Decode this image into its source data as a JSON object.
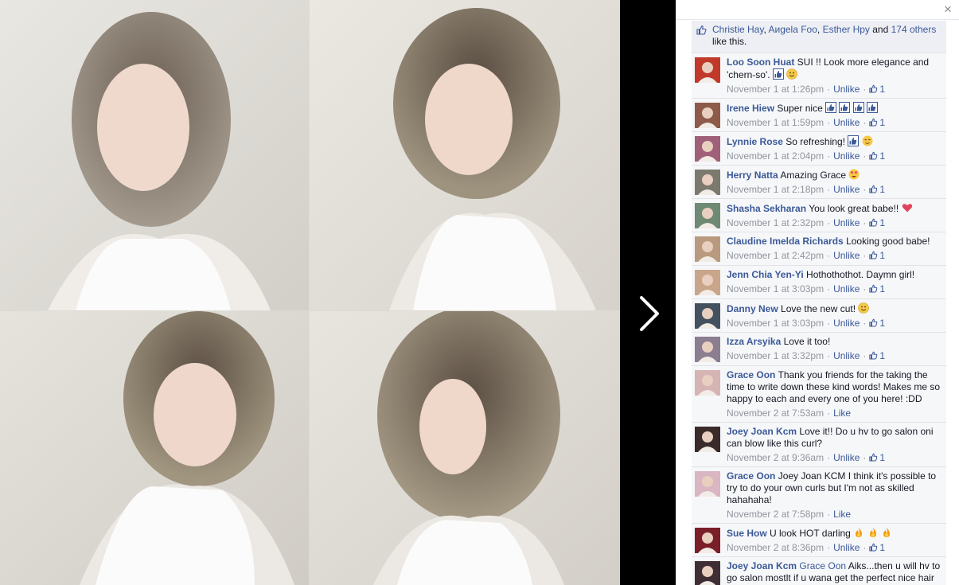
{
  "colors": {
    "link": "#3b5998",
    "meta": "#90949c",
    "panel_bg": "#f6f7f9",
    "stage_bg": "#000000"
  },
  "viewer": {
    "next_icon": "chevron-right-icon",
    "close_label": "×"
  },
  "likes": {
    "names": [
      "Christie Hay",
      "Aиgela Foo",
      "Esther Hpy"
    ],
    "sep1": ", ",
    "sep2": ", ",
    "and_text": " and ",
    "others": "174 others",
    "tail": "like this."
  },
  "comments": [
    {
      "name": "Loo Soon Huat",
      "text": "SUI !! Look more elegance and 'chern-so'.",
      "emoji": [
        "thumbs-up-icon",
        "smile-icon"
      ],
      "time": "November 1 at 1:26pm",
      "action": "Unlike",
      "count": "1"
    },
    {
      "name": "Irene Hiew",
      "text": "Super nice",
      "emoji": [
        "thumbs-up-icon",
        "thumbs-up-icon",
        "thumbs-up-icon",
        "thumbs-up-icon"
      ],
      "time": "November 1 at 1:59pm",
      "action": "Unlike",
      "count": "1"
    },
    {
      "name": "Lynnie Rose",
      "text": "So refreshing!",
      "emoji": [
        "thumbs-up-icon",
        "relieved-face-icon"
      ],
      "time": "November 1 at 2:04pm",
      "action": "Unlike",
      "count": "1"
    },
    {
      "name": "Herry Natta",
      "text": "Amazing Grace",
      "emoji": [
        "heart-eyes-icon"
      ],
      "time": "November 1 at 2:18pm",
      "action": "Unlike",
      "count": "1"
    },
    {
      "name": "Shasha Sekharan",
      "text": "You look great babe!!",
      "emoji": [
        "heart-icon"
      ],
      "time": "November 1 at 2:32pm",
      "action": "Unlike",
      "count": "1"
    },
    {
      "name": "Claudine Imelda Richards",
      "text": "Looking good babe!",
      "emoji": [],
      "time": "November 1 at 2:42pm",
      "action": "Unlike",
      "count": "1"
    },
    {
      "name": "Jenn Chia Yen-Yi",
      "text": "Hothothothot. Daymn girl!",
      "emoji": [],
      "time": "November 1 at 3:03pm",
      "action": "Unlike",
      "count": "1"
    },
    {
      "name": "Danny New",
      "text": "Love the new cut!",
      "emoji": [
        "smile-icon"
      ],
      "time": "November 1 at 3:03pm",
      "action": "Unlike",
      "count": "1"
    },
    {
      "name": "Izza Arsyika",
      "text": "Love it too!",
      "emoji": [],
      "time": "November 1 at 3:32pm",
      "action": "Unlike",
      "count": "1"
    },
    {
      "name": "Grace Oon",
      "text": "Thank you friends for the taking the time to write down these kind words! Makes me so happy to each and every one of you here! :DD",
      "emoji": [],
      "time": "November 2 at 7:53am",
      "action": "Like",
      "count": ""
    },
    {
      "name": "Joey Joan Kcm",
      "text": "Love it!! Do u hv to go salon oni can blow like this curl?",
      "emoji": [],
      "time": "November 2 at 9:36am",
      "action": "Unlike",
      "count": "1"
    },
    {
      "name": "Grace Oon",
      "text": "Joey Joan KCM I think it's possible to try to do your own curls but I'm not as skilled hahahaha!",
      "emoji": [],
      "time": "November 2 at 7:58pm",
      "action": "Like",
      "count": ""
    },
    {
      "name": "Sue How",
      "text": "U look HOT darling",
      "emoji": [
        "fire-icon",
        "fire-icon",
        "fire-icon"
      ],
      "time": "November 2 at 8:36pm",
      "action": "Unlike",
      "count": "1"
    },
    {
      "name": "Joey Joan Kcm",
      "mention": "Grace Oon",
      "text": " Aiks...then u will hv to go salon mostlt if u wana get the perfect nice hair curls?",
      "emoji": [],
      "time": "",
      "action": "",
      "count": ""
    }
  ]
}
